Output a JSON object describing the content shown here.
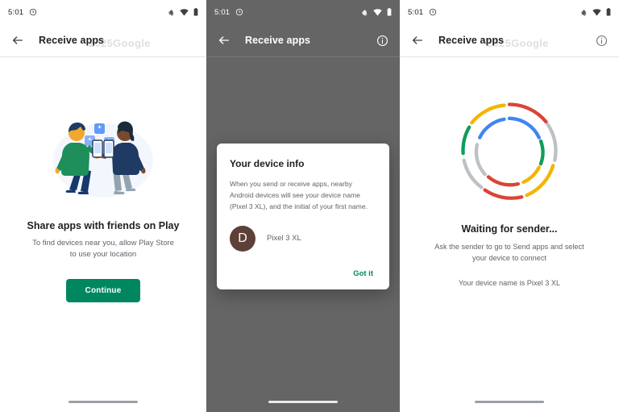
{
  "watermark": "2025Google",
  "status_bar": {
    "time": "5:01",
    "left_icon": "alarm-circle-icon",
    "right_icons": [
      "notifications-off-icon",
      "wifi-icon",
      "battery-icon"
    ]
  },
  "panels": [
    {
      "id": "share-apps-permission",
      "appbar": {
        "back_icon": "back-arrow-icon",
        "title": "Receive apps",
        "has_info": false
      },
      "illustration": "two-people-sharing-apps-illustration",
      "title": "Share apps with friends on Play",
      "subtitle": "To find devices near you, allow Play Store to use your location",
      "button": "Continue"
    },
    {
      "id": "device-info-dialog",
      "appbar": {
        "back_icon": "back-arrow-icon",
        "title": "Receive apps",
        "has_info": true,
        "info_icon": "info-icon"
      },
      "dialog": {
        "title": "Your device info",
        "body": "When you send or receive apps, nearby Android devices will see your device name (Pixel 3 XL), and the initial of your first name.",
        "avatar_initial": "D",
        "avatar_color": "#5d4037",
        "device_name": "Pixel 3 XL",
        "action": "Got it"
      }
    },
    {
      "id": "waiting-for-sender",
      "appbar": {
        "back_icon": "back-arrow-icon",
        "title": "Receive apps",
        "has_info": true,
        "info_icon": "info-icon"
      },
      "spinner": "google-colors-dual-ring-spinner",
      "title": "Waiting for sender...",
      "subtitle": "Ask the sender to go to Send apps and select your device to connect",
      "note": "Your device name is Pixel 3 XL"
    }
  ],
  "colors": {
    "accent_green": "#01875f",
    "scrim": "#656565",
    "text_primary": "#202124",
    "text_secondary": "#5f6368",
    "google_blue": "#4285f4",
    "google_red": "#db4437",
    "google_yellow": "#f4b400",
    "google_green": "#0f9d58",
    "ring_gray": "#bdc1c6"
  }
}
